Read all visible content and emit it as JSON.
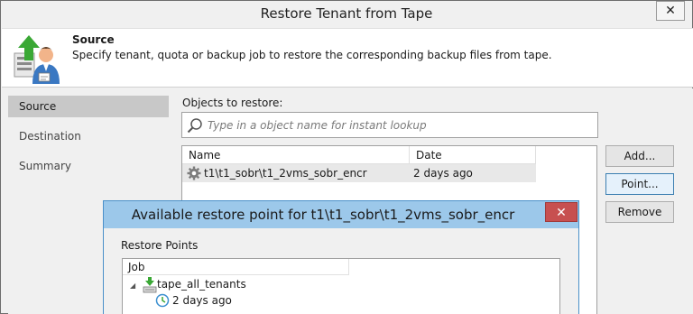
{
  "window": {
    "title": "Restore Tenant from Tape",
    "close_glyph": "✕"
  },
  "header": {
    "title": "Source",
    "description": "Specify tenant, quota or backup job to restore the corresponding backup files from tape.",
    "icon": "restore-wizard-icon"
  },
  "sidebar": {
    "items": [
      {
        "label": "Source",
        "active": true
      },
      {
        "label": "Destination",
        "active": false
      },
      {
        "label": "Summary",
        "active": false
      }
    ]
  },
  "objects": {
    "label": "Objects to restore:",
    "search_placeholder": "Type in a object name for instant lookup",
    "columns": [
      "Name",
      "Date"
    ],
    "rows": [
      {
        "name": "t1\\t1_sobr\\t1_2vms_sobr_encr",
        "date": "2 days ago",
        "icon": "gear-icon"
      }
    ]
  },
  "buttons": {
    "add": "Add...",
    "point": "Point...",
    "remove": "Remove"
  },
  "dialog": {
    "title": "Available restore point for t1\\t1_sobr\\t1_2vms_sobr_encr",
    "close_glyph": "✕",
    "restore_points_label": "Restore Points",
    "column": "Job",
    "tree": {
      "job_name": "tape_all_tenants",
      "expander": "◢",
      "point": "2 days ago"
    }
  },
  "colors": {
    "accent": "#4a90c9",
    "dialog_titlebar": "#9cc8ea",
    "close_red": "#c75050",
    "selected_nav": "#c8c8c8"
  }
}
